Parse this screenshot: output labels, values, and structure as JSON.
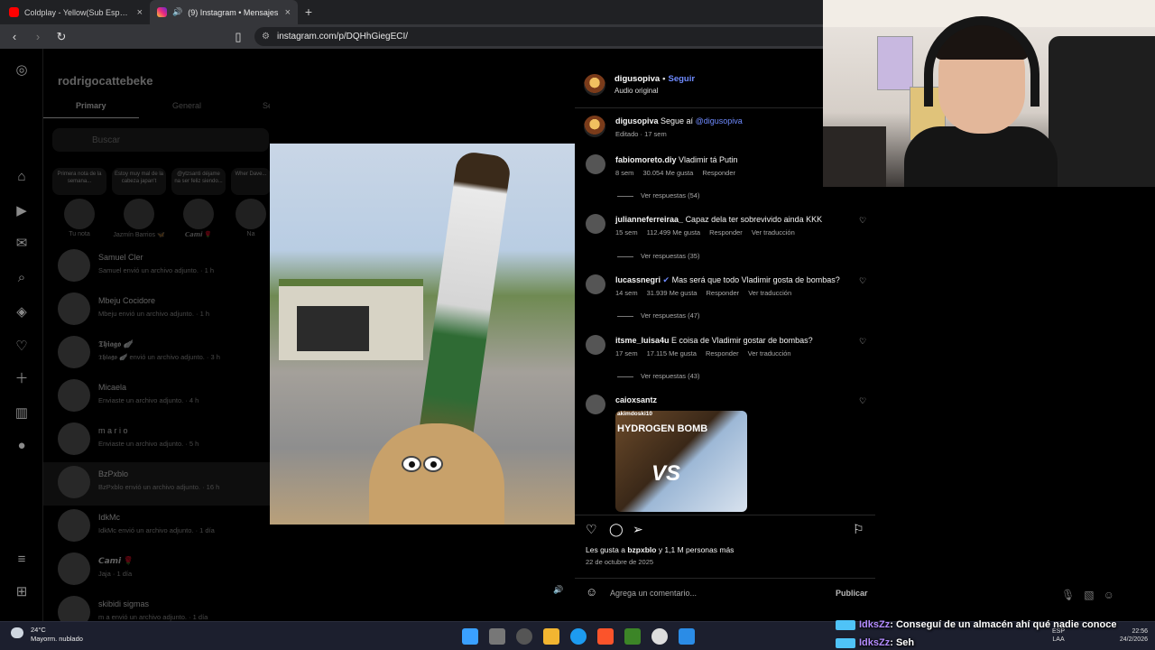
{
  "browser": {
    "tabs": [
      {
        "title": "Coldplay - Yellow(Sub Español + Lyric",
        "icon": "youtube-icon",
        "active": false
      },
      {
        "title": "(9) Instagram • Mensajes",
        "icon": "instagram-icon",
        "active": true
      }
    ],
    "new_tab": "+",
    "url": "instagram.com/p/DQHhGiegECI/"
  },
  "inbox": {
    "username": "rodrigocattebeke",
    "tabs": [
      "Primary",
      "General",
      "Se"
    ],
    "search_placeholder": "Buscar",
    "notes": [
      {
        "text": "Primera nota de la semana...",
        "label": "Tu nota"
      },
      {
        "text": "Estoy muy mal de la cabeza japan't",
        "label": "Jazmín Barrios 🦋"
      },
      {
        "text": "@ytzsanti déjame na ser feliz siendo...",
        "label": "𝘾𝙖𝙢𝙞 🌹"
      },
      {
        "text": "Wher Dave...",
        "label": "Na"
      }
    ],
    "conversations": [
      {
        "name": "Samuel Cler",
        "preview": "Samuel envió un archivo adjunto.",
        "time": "· 1 h"
      },
      {
        "name": "Mbeju Cocidore",
        "preview": "Mbeju envió un archivo adjunto.",
        "time": "· 1 h"
      },
      {
        "name": "𝕿𝖍𝖎𝖆𝖌𝖔 🪽",
        "preview": "𝕿𝖍𝖎𝖆𝖌𝖔 🪽 envió un archivo adjunto.",
        "time": "· 3 h"
      },
      {
        "name": "Micaela",
        "preview": "Enviaste un archivo adjunto.",
        "time": "· 4 h"
      },
      {
        "name": "m a r i o",
        "preview": "Enviaste un archivo adjunto.",
        "time": "· 5 h"
      },
      {
        "name": "BzPxblo",
        "preview": "BzPxblo envió un archivo adjunto.",
        "time": "· 16 h"
      },
      {
        "name": "IdkMc",
        "preview": "IdkMc envió un archivo adjunto.",
        "time": "· 1 día"
      },
      {
        "name": "𝘾𝙖𝙢𝙞 🌹",
        "preview": "Jaja",
        "time": "· 1 día"
      },
      {
        "name": "skibidi sigmas",
        "preview": "m a envió un archivo adjunto.",
        "time": "· 1 día"
      }
    ]
  },
  "post": {
    "author": "digusopiva",
    "dot": "•",
    "follow": "Seguir",
    "audio": "Audio original",
    "caption_user": "digusopiva",
    "caption_text": "Segue aí",
    "caption_mention": "@digusopiva",
    "caption_meta": "Editado · 17 sem",
    "comments": [
      {
        "user": "fabiomoreto.diy",
        "text": "Vladimir tá Putin",
        "age": "8 sem",
        "likes": "30.054 Me gusta",
        "reply": "Responder",
        "translate": "",
        "replies": "Ver respuestas (54)"
      },
      {
        "user": "julianneferreiraa_",
        "text": "Capaz dela ter sobrevivido ainda KKK",
        "age": "15 sem",
        "likes": "112.499 Me gusta",
        "reply": "Responder",
        "translate": "Ver traducción",
        "replies": "Ver respuestas (35)"
      },
      {
        "user": "lucassnegri",
        "text": "Mas será que todo Vladimir gosta de bombas?",
        "age": "14 sem",
        "likes": "31.939 Me gusta",
        "reply": "Responder",
        "translate": "Ver traducción",
        "replies": "Ver respuestas (47)"
      },
      {
        "user": "itsme_luisa4u",
        "text": "E coisa de Vladimir gostar de bombas?",
        "age": "17 sem",
        "likes": "17.115 Me gusta",
        "reply": "Responder",
        "translate": "Ver traducción",
        "replies": "Ver respuestas (43)"
      }
    ],
    "gif_comment": {
      "user": "caioxsantz",
      "gif_top": "akimdoski10",
      "gif_title": "HYDROGEN BOMB",
      "gif_vs": "VS"
    },
    "likes_prefix": "Les gusta a",
    "likes_user": "bzpxblo",
    "likes_suffix": "y 1,1 M personas más",
    "date": "22 de octubre de 2025",
    "comment_placeholder": "Agrega un comentario...",
    "publish": "Publicar"
  },
  "taskbar": {
    "temp": "24°C",
    "weather": "Mayorm. nublado",
    "lang1": "ESP",
    "lang2": "LAA",
    "time": "22:56",
    "date": "24/2/2026"
  },
  "chat": [
    {
      "user": "IdksZz",
      "text": ": Conseguí de un almacén ahí qué nadie conoce"
    },
    {
      "user": "IdksZz",
      "text": ": Seh"
    }
  ],
  "colors": {
    "accent": "#6f8bff",
    "chat_user": "#b48cff",
    "taskbar": "#1c1f2e"
  }
}
